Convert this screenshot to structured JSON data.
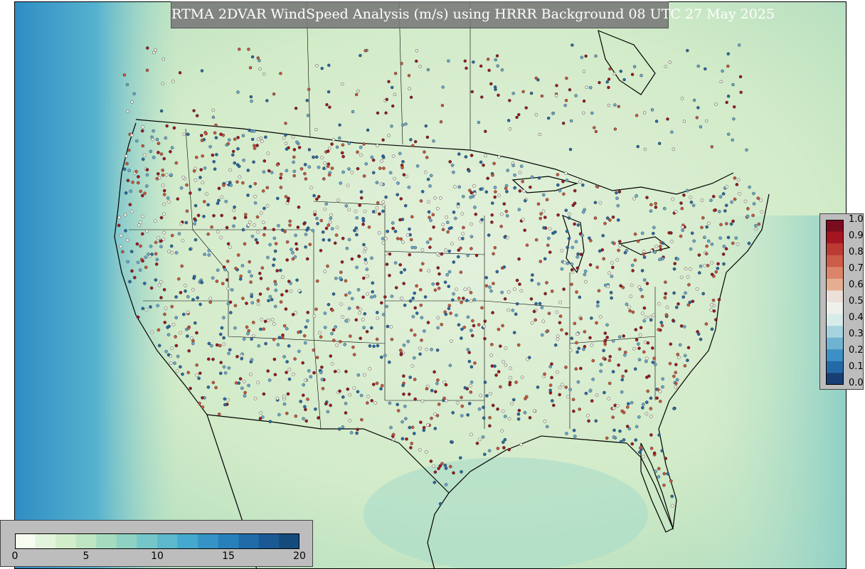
{
  "title": "RTMA 2DVAR WindSpeed Analysis (m/s) using HRRR Background 08 UTC 27 May 2025",
  "title_visible": "RTMA 2DVAR WindSpeed Analysis (m/s) using HRRR Background 08 UTC 27 May 2025",
  "colorbar_obs": {
    "ticks": [
      "1.0",
      "0.9",
      "0.8",
      "0.7",
      "0.6",
      "0.5",
      "0.4",
      "0.3",
      "0.2",
      "0.1",
      "0.0"
    ],
    "colors": [
      "#7a0c1f",
      "#a3151f",
      "#bb3a34",
      "#cc5b47",
      "#db8469",
      "#e6ad93",
      "#ece0d8",
      "#eef0ec",
      "#d7ebe9",
      "#a6d3de",
      "#6fb2d1",
      "#3e8fc3",
      "#2369a8",
      "#183f73"
    ]
  },
  "colorbar_windspeed": {
    "ticks": [
      "0",
      "5",
      "10",
      "15",
      "20"
    ],
    "colors": [
      "#f7fcf0",
      "#e3f4dc",
      "#d2edc9",
      "#bde5c2",
      "#a6dbbf",
      "#8fd1c2",
      "#75c6c8",
      "#5cb8cc",
      "#45a8ce",
      "#3594c5",
      "#2880ba",
      "#1f6ca8",
      "#1a5994",
      "#154a7c"
    ]
  },
  "colors": {
    "station_red": "#9c1a22",
    "station_blue": "#2a6aa6",
    "station_white": "#f2efe6"
  }
}
